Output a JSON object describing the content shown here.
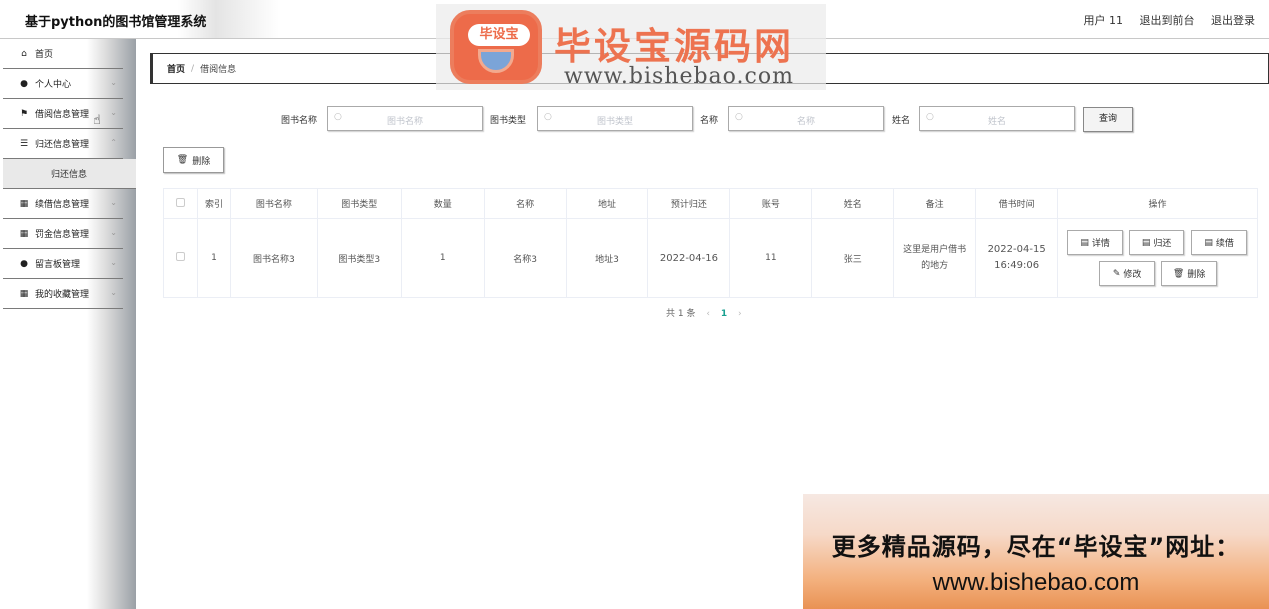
{
  "header": {
    "title": "基于python的图书馆管理系统",
    "user": "用户 11",
    "back_to_front": "退出到前台",
    "logout": "退出登录"
  },
  "sidebar": {
    "items": [
      {
        "label": "首页",
        "icon": "home-icon"
      },
      {
        "label": "个人中心",
        "icon": "user-icon"
      },
      {
        "label": "借阅信息管理",
        "icon": "flag-icon"
      },
      {
        "label": "归还信息管理",
        "icon": "list-icon"
      },
      {
        "label": "续借信息管理",
        "icon": "grid-icon"
      },
      {
        "label": "罚金信息管理",
        "icon": "grid-icon"
      },
      {
        "label": "留言板管理",
        "icon": "user-icon"
      },
      {
        "label": "我的收藏管理",
        "icon": "grid-icon"
      }
    ],
    "submenu_item": "归还信息"
  },
  "breadcrumb": {
    "home": "首页",
    "separator": "/",
    "current": "借阅信息"
  },
  "search": {
    "book_name_label": "图书名称",
    "book_name_placeholder": "图书名称",
    "book_type_label": "图书类型",
    "book_type_placeholder": "图书类型",
    "name_label": "名称",
    "name_placeholder": "名称",
    "person_label": "姓名",
    "person_placeholder": "姓名",
    "query_button": "查询"
  },
  "toolbar": {
    "delete_label": "删除"
  },
  "table": {
    "headers": [
      "索引",
      "图书名称",
      "图书类型",
      "数量",
      "名称",
      "地址",
      "预计归还",
      "账号",
      "姓名",
      "备注",
      "借书时间",
      "操作"
    ],
    "rows": [
      {
        "index": "1",
        "book_name": "图书名称3",
        "book_type": "图书类型3",
        "quantity": "1",
        "name": "名称3",
        "address": "地址3",
        "expected_return": "2022-04-16",
        "account": "11",
        "person": "张三",
        "remark": "这里是用户借书的地方",
        "borrow_time": "2022-04-15 16:49:06"
      }
    ],
    "actions": {
      "detail": "详情",
      "return": "归还",
      "renew": "续借",
      "edit": "修改",
      "delete": "删除"
    }
  },
  "pagination": {
    "total": "共 1 条",
    "current_page": "1",
    "prev": "‹",
    "next": "›"
  },
  "watermark": {
    "title": "毕设宝源码网",
    "url": "www.bishebao.com",
    "badge": "毕设宝"
  },
  "promo": {
    "line1": "更多精品源码，尽在“毕设宝”网址：",
    "line2": "www.bishebao.com"
  },
  "colors": {
    "accent": "#1aa090",
    "watermark_orange": "#ed7350"
  }
}
